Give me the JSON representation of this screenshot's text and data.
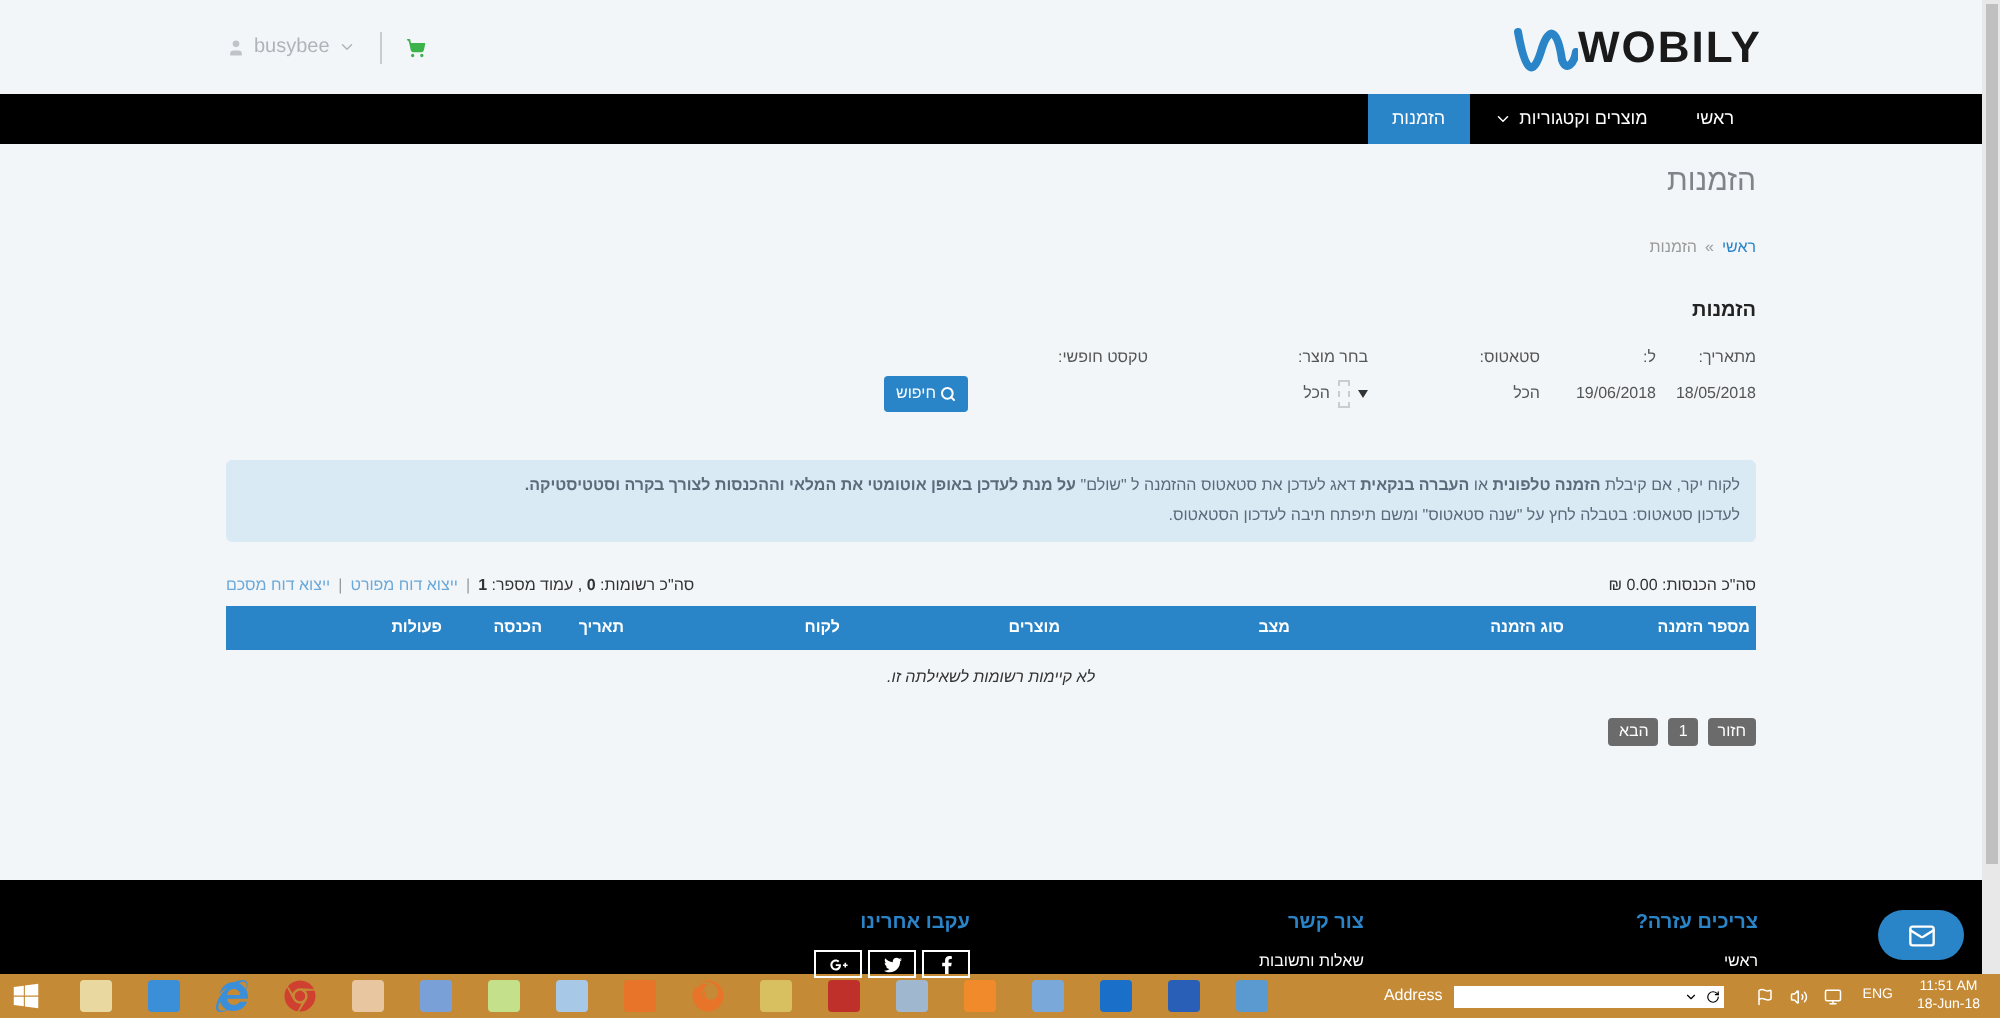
{
  "header": {
    "user": "busybee",
    "logo": "WOBILY"
  },
  "nav": [
    {
      "label": "ראשי",
      "selected": false,
      "has_dropdown": false
    },
    {
      "label": "מוצרים וקטגוריות",
      "selected": false,
      "has_dropdown": true
    },
    {
      "label": "הזמנות",
      "selected": true,
      "has_dropdown": false
    }
  ],
  "page_title": "הזמנות",
  "breadcrumb": {
    "separator": "»",
    "items": [
      {
        "label": "ראשי",
        "kind": "link"
      },
      {
        "label": "הזמנות",
        "kind": "current"
      }
    ]
  },
  "section_title": "הזמנות",
  "filters": [
    {
      "label": "מתאריך:",
      "value": "18/05/2018",
      "kind": "text"
    },
    {
      "label": "ל:",
      "value": "19/06/2018",
      "kind": "text"
    },
    {
      "label": "סטאטוס:",
      "value": "הכל",
      "kind": "text"
    },
    {
      "label": "בחר מוצר:",
      "value": "הכל",
      "kind": "select"
    },
    {
      "label": "טקסט חופשי:",
      "kind": "input"
    }
  ],
  "search_button": "חיפוש",
  "info": [
    "לקוח יקר, אם קיבלת **הזמנה טלפונית** או **העברה בנקאית** דאג לעדכן את סטאטוס ההזמנה ל \"שולם\" **על מנת לעדכן באופן אוטומטי את המלאי וההכנסות לצורך בקרה וסטטיסטיקה.**",
    "לעדכון סטאטוס: בטבלה לחץ על \"שנה סטאטוס\" ומשם תיפתח תיבה לעדכון הסטאטוס."
  ],
  "summary": {
    "income": "סה\"כ הכנסות: 0.00 ₪",
    "records": "סה\"כ רשומות: **0** , עמוד מספר: **1**",
    "links": [
      "ייצוא דוח מפורט",
      "ייצוא דוח מסכם"
    ],
    "link_separator": "|"
  },
  "table": {
    "columns": [
      "מספר הזמנה",
      "סוג הזמנה",
      "מצב",
      "מוצרים",
      "לקוח",
      "תאריך",
      "הכנסה",
      "פעולות"
    ],
    "empty_message": "לא קיימות רשומות לשאילתה זו."
  },
  "pagination": [
    "חזור",
    "1",
    "הבא"
  ],
  "footer": [
    {
      "title": "צריכים עזרה?",
      "links": [
        "ראשי"
      ]
    },
    {
      "title": "צור קשר",
      "links": [
        "שאלות ותשובות"
      ]
    },
    {
      "title": "עקבו אחרינו",
      "social": [
        {
          "kind": "facebook"
        },
        {
          "kind": "twitter"
        },
        {
          "kind": "google-plus"
        }
      ]
    }
  ],
  "taskbar": {
    "address_label": "Address",
    "language": "ENG",
    "time": "11:51 AM",
    "date": "18-Jun-18"
  }
}
